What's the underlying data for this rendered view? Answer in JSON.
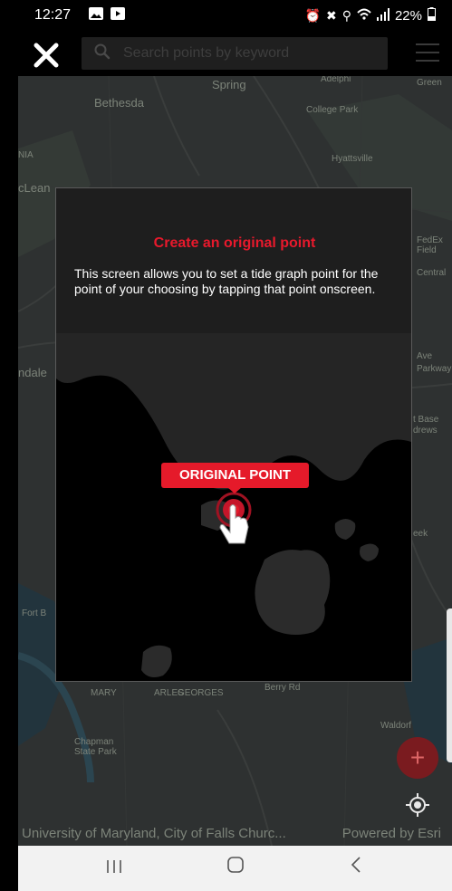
{
  "status_bar": {
    "time": "12:27",
    "battery": "22%"
  },
  "search": {
    "placeholder": "Search points by keyword"
  },
  "map": {
    "labels": {
      "spring": "Spring",
      "bethesda": "Bethesda",
      "college_park": "College Park",
      "hyattsville": "Hyattsville",
      "mclean": "cLean",
      "nia": "NIA",
      "andale": "ndale",
      "fedex": "FedEx Field",
      "central": "Central",
      "ave": "Ave",
      "parkway": "Parkway",
      "base": "t Base",
      "drews": "drews",
      "berry_rd": "Berry Rd",
      "waldorf": "Waldorf",
      "chapman": "Chapman State Park",
      "george": "GEORGES",
      "charles": "ARLES",
      "mary": "MARY",
      "adelphi": "Adelphi",
      "green": "Green",
      "eek": "eek",
      "fort": "Fort B"
    },
    "attribution": "University of Maryland, City of Falls Churc...",
    "powered_by": "Powered by Esri"
  },
  "modal": {
    "title": "Create an original point",
    "body": "This screen allows you to set a tide graph point for the point of your choosing by tapping that point onscreen.",
    "point_label": "ORIGINAL POINT"
  },
  "colors": {
    "accent": "#e51a2a",
    "fab": "#7a1b1f"
  }
}
